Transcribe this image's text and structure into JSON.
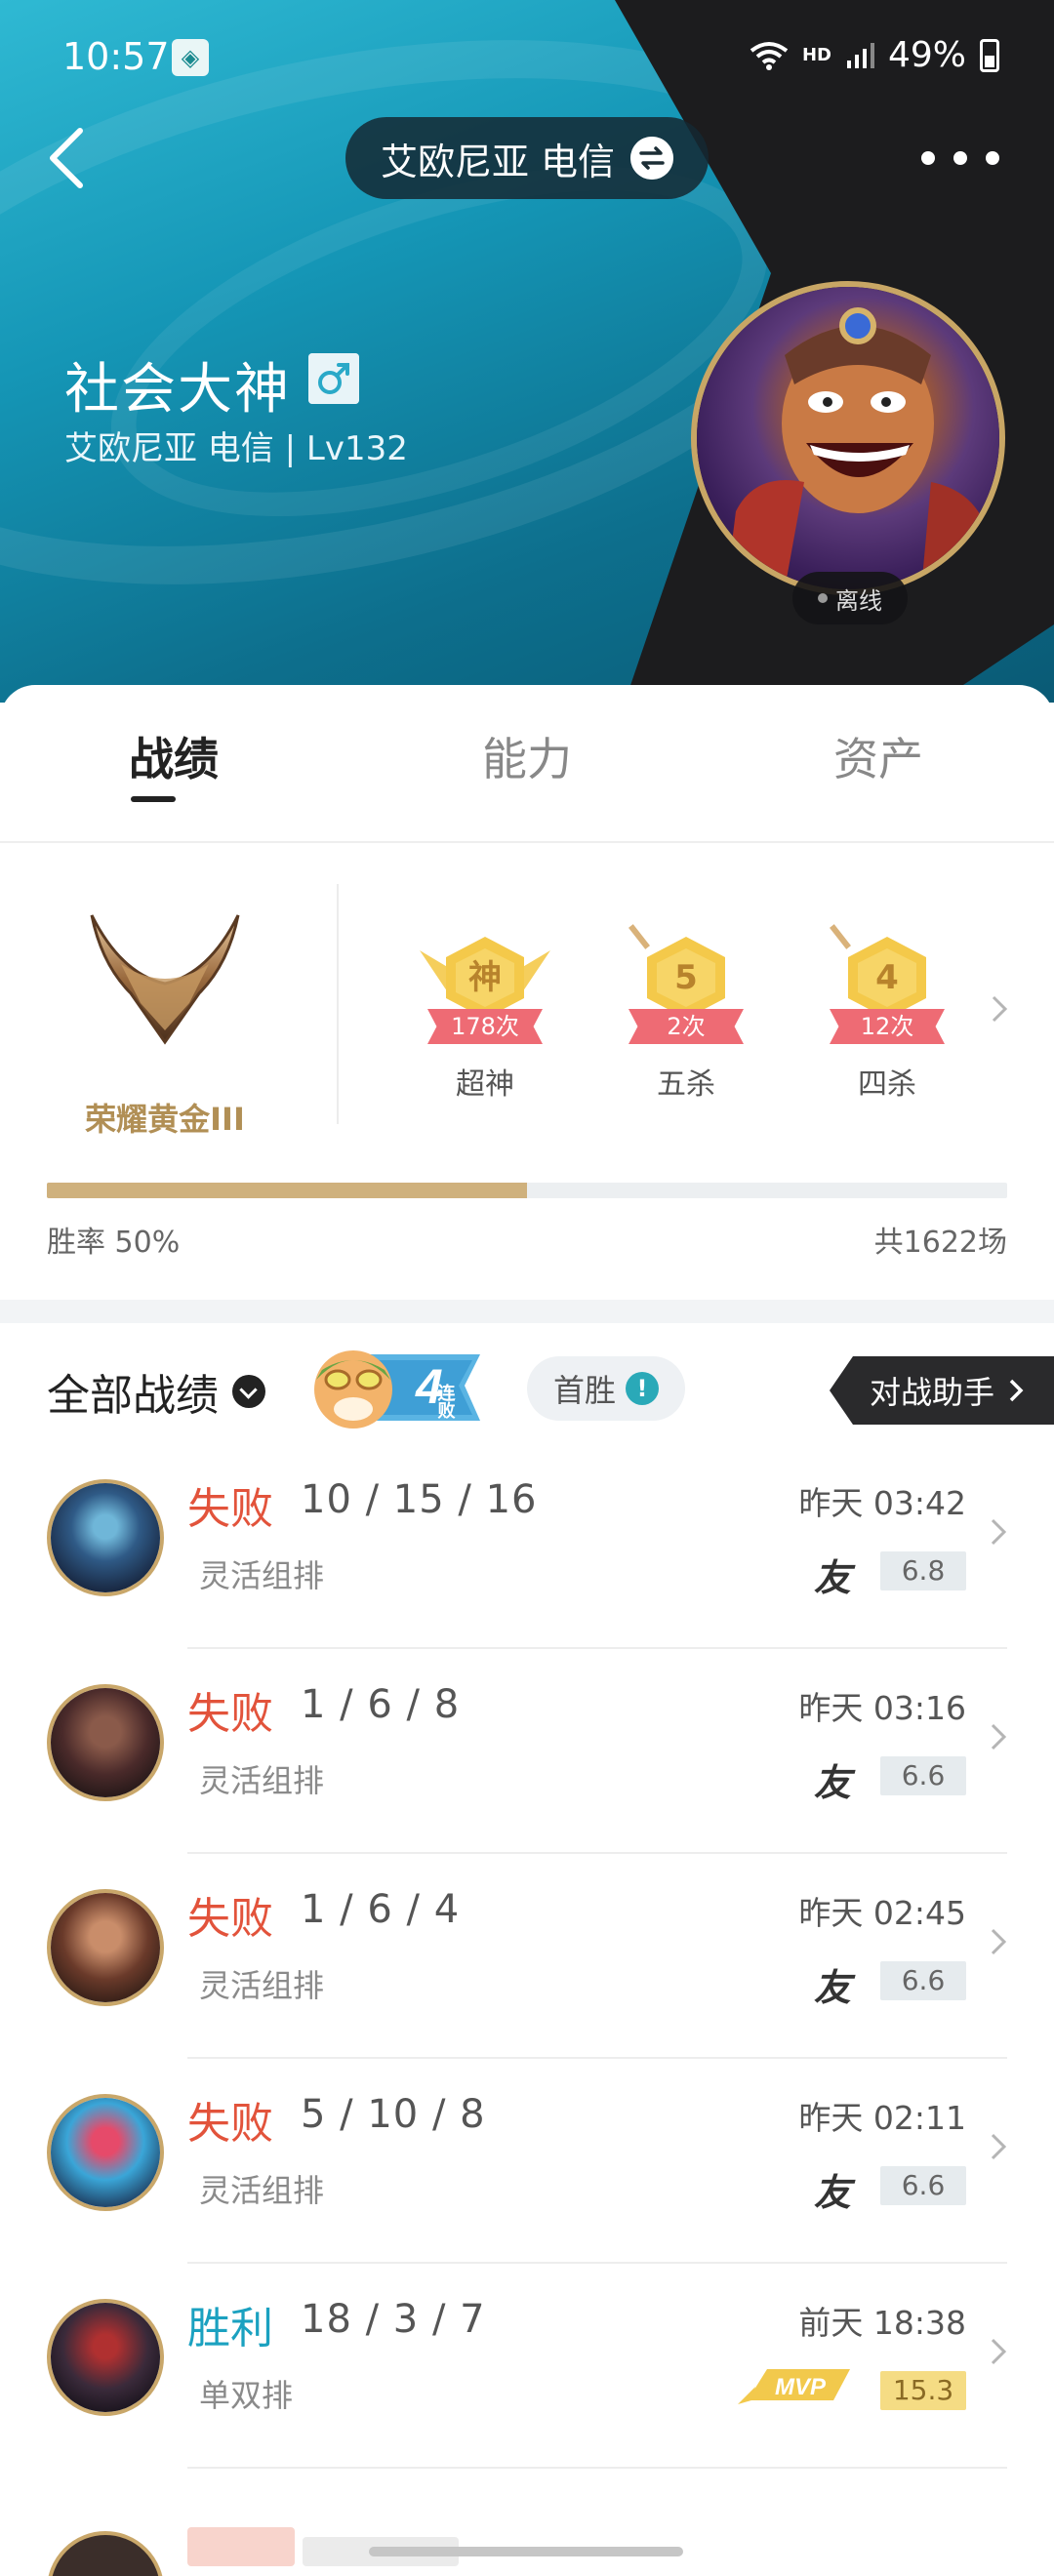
{
  "status_bar": {
    "time": "10:57",
    "network": "HD",
    "battery": "49%"
  },
  "header": {
    "server": "艾欧尼亚 电信",
    "icons": [
      "back-icon",
      "swap-icon",
      "more-icon"
    ]
  },
  "profile": {
    "name": "社会大神",
    "gender": "male",
    "subtitle": "艾欧尼亚 电信 | Lv132",
    "status": "离线"
  },
  "tabs": [
    {
      "label": "战绩",
      "active": true
    },
    {
      "label": "能力",
      "active": false
    },
    {
      "label": "资产",
      "active": false
    }
  ],
  "rank": {
    "name": "荣耀黄金III"
  },
  "honors": [
    {
      "glyph": "神",
      "count": "178次",
      "label": "超神"
    },
    {
      "glyph": "5",
      "count": "2次",
      "label": "五杀"
    },
    {
      "glyph": "4",
      "count": "12次",
      "label": "四杀"
    }
  ],
  "stats": {
    "winrate_label": "胜率  50%",
    "winrate_fraction": 0.5,
    "total": "共1622场"
  },
  "list_header": {
    "all_records": "全部战绩",
    "streak_number": "4",
    "streak_text": "连败",
    "first_win": "首胜",
    "first_win_info": "!",
    "assistant": "对战助手"
  },
  "matches": [
    {
      "result": "失败",
      "kind": "loss",
      "kda": "10 / 15 / 16",
      "mode": "灵活组排",
      "time": "昨天 03:42",
      "tag": "友",
      "score": "6.8",
      "mvp": false
    },
    {
      "result": "失败",
      "kind": "loss",
      "kda": "1 / 6 / 8",
      "mode": "灵活组排",
      "time": "昨天 03:16",
      "tag": "友",
      "score": "6.6",
      "mvp": false
    },
    {
      "result": "失败",
      "kind": "loss",
      "kda": "1 / 6 / 4",
      "mode": "灵活组排",
      "time": "昨天 02:45",
      "tag": "友",
      "score": "6.6",
      "mvp": false
    },
    {
      "result": "失败",
      "kind": "loss",
      "kda": "5 / 10 / 8",
      "mode": "灵活组排",
      "time": "昨天 02:11",
      "tag": "友",
      "score": "6.6",
      "mvp": false
    },
    {
      "result": "胜利",
      "kind": "win",
      "kda": "18 / 3 / 7",
      "mode": "单双排",
      "time": "前天 18:38",
      "tag": "MVP",
      "score": "15.3",
      "mvp": true
    }
  ],
  "colors": {
    "loss": "#e2533b",
    "win": "#1ba1c0",
    "gold": "#b18f55",
    "banner_teal": "#1596b6",
    "banner_dark": "#1c1c1e"
  }
}
